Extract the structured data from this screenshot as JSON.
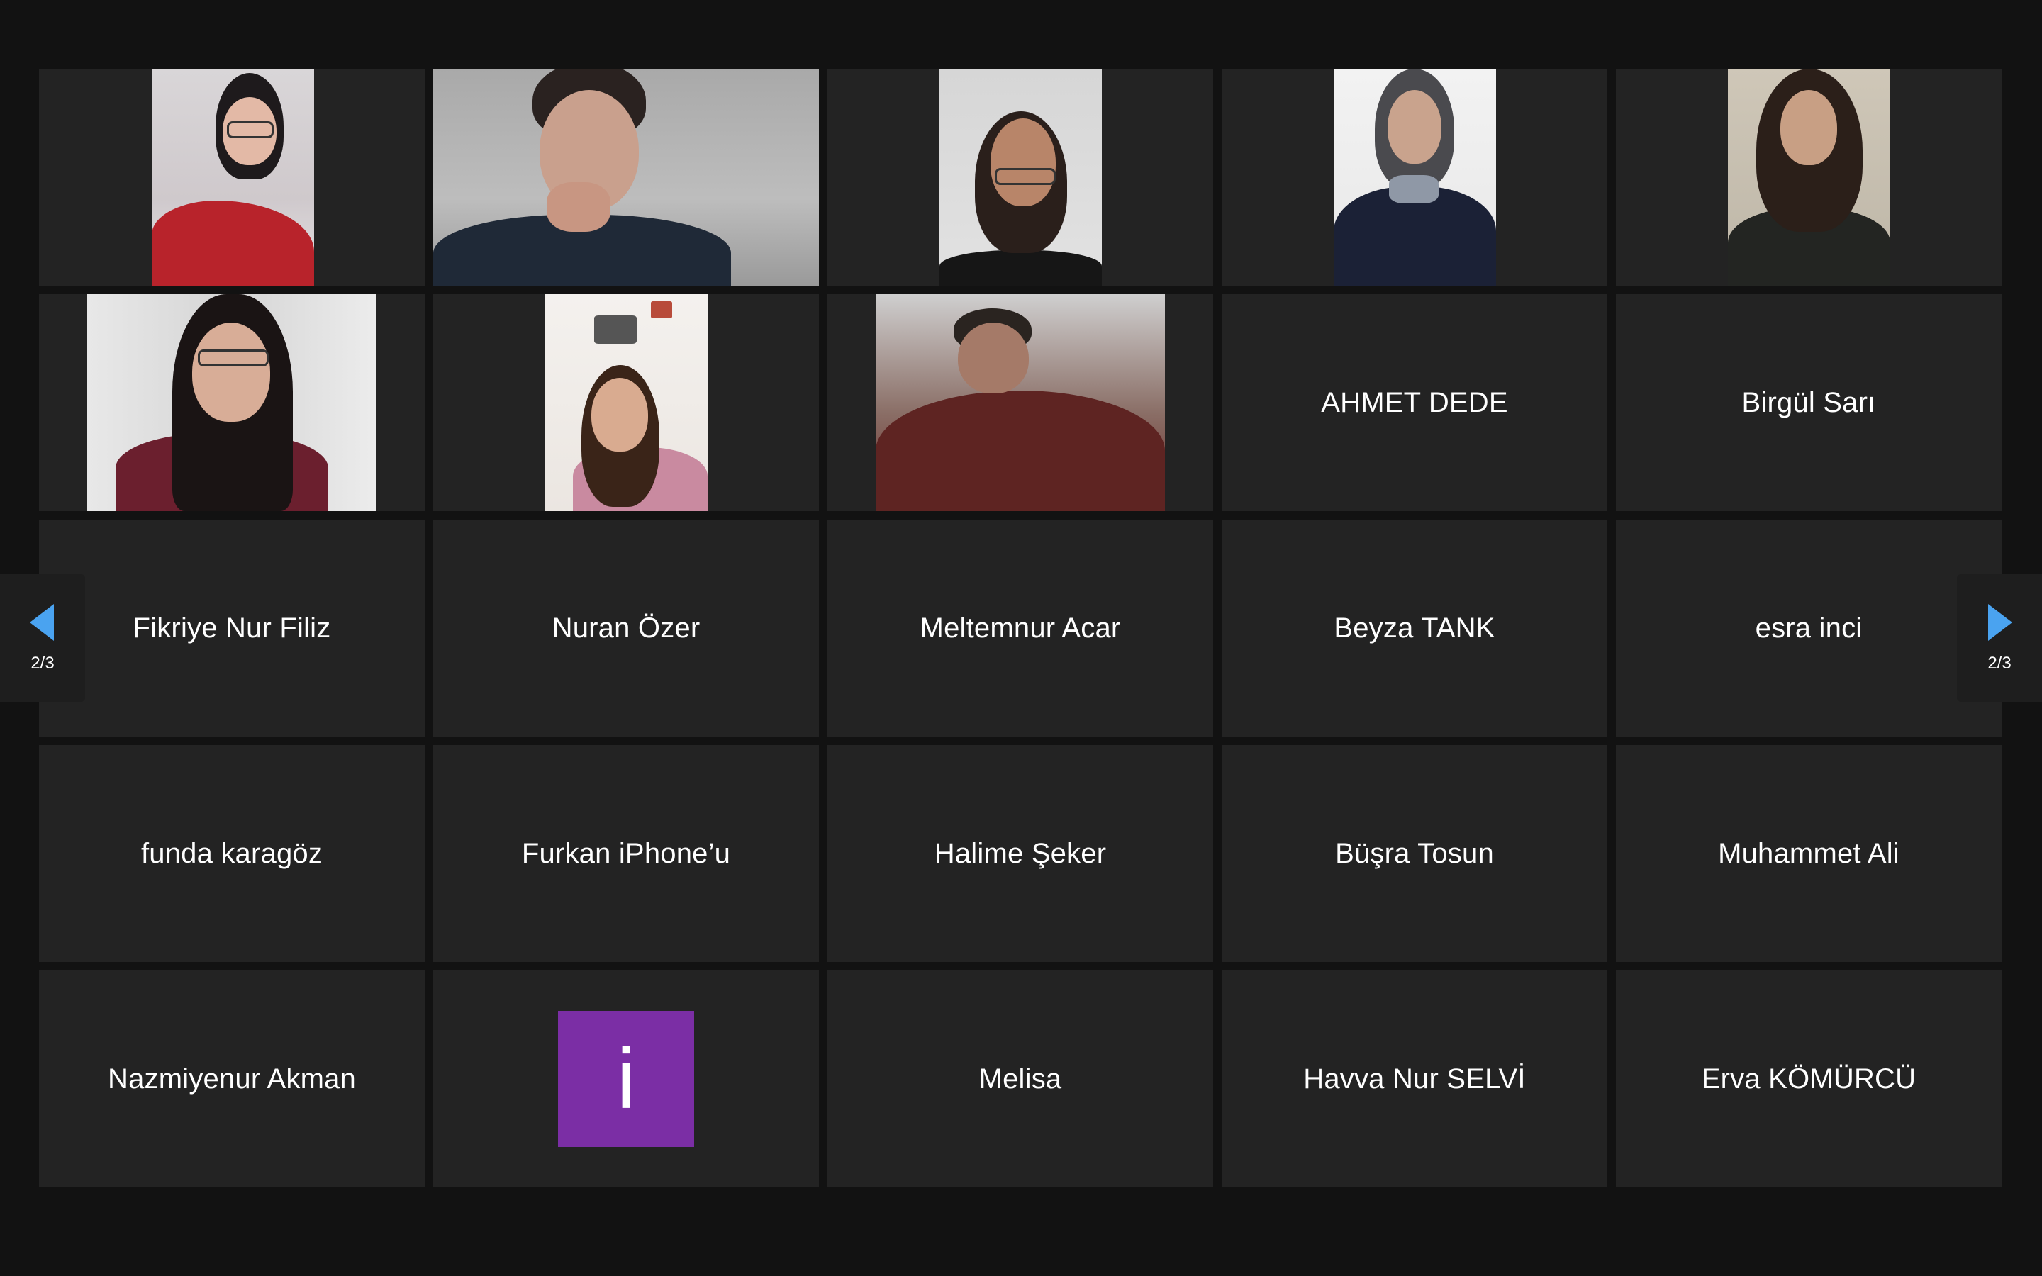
{
  "meeting": {
    "pager": {
      "left_label": "2/3",
      "right_label": "2/3"
    },
    "participants": [
      {
        "name": "",
        "video": true
      },
      {
        "name": "",
        "video": true
      },
      {
        "name": "",
        "video": true
      },
      {
        "name": "",
        "video": true
      },
      {
        "name": "",
        "video": true
      },
      {
        "name": "",
        "video": true
      },
      {
        "name": "",
        "video": true
      },
      {
        "name": "",
        "video": true
      },
      {
        "name": "AHMET DEDE",
        "video": false
      },
      {
        "name": "Birgül Sarı",
        "video": false
      },
      {
        "name": "Fikriye Nur Filiz",
        "video": false
      },
      {
        "name": "Nuran Özer",
        "video": false
      },
      {
        "name": "Meltemnur Acar",
        "video": false
      },
      {
        "name": "Beyza TANK",
        "video": false
      },
      {
        "name": "esra inci",
        "video": false
      },
      {
        "name": "funda karagöz",
        "video": false
      },
      {
        "name": "Furkan iPhone’u",
        "video": false
      },
      {
        "name": "Halime Şeker",
        "video": false
      },
      {
        "name": "Büşra Tosun",
        "video": false
      },
      {
        "name": "Muhammet Ali",
        "video": false
      },
      {
        "name": "Nazmiyenur Akman",
        "video": false
      },
      {
        "name": "",
        "video": false,
        "avatar_letter": "i",
        "avatar_color": "#7b2ea5"
      },
      {
        "name": "Melisa",
        "video": false
      },
      {
        "name": "Havva Nur SELVİ",
        "video": false
      },
      {
        "name": "Erva KÖMÜRCÜ",
        "video": false
      }
    ]
  },
  "colors": {
    "background": "#121212",
    "tile": "#232323",
    "arrow": "#4aa3f0",
    "avatar": "#7b2ea5"
  }
}
